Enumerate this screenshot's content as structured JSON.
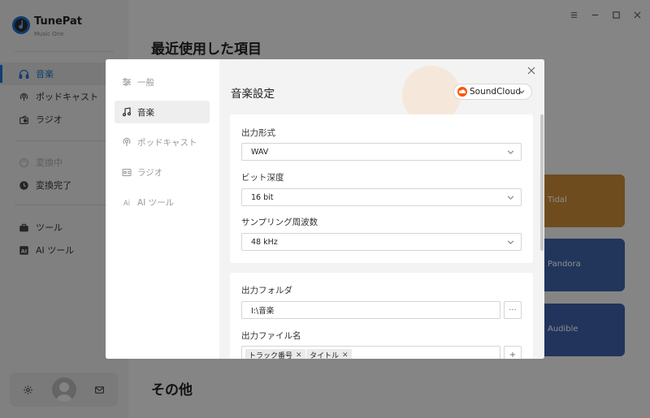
{
  "app": {
    "name": "TunePat",
    "subtitle": "Music One",
    "nav_sources": [
      {
        "label": "音楽",
        "icon": "headphones-icon"
      },
      {
        "label": "ポッドキャスト",
        "icon": "podcast-icon"
      },
      {
        "label": "ラジオ",
        "icon": "radio-icon"
      }
    ],
    "nav_tasks": [
      {
        "label": "変換中",
        "icon": "converting-icon"
      },
      {
        "label": "変換完了",
        "icon": "clock-icon"
      }
    ],
    "nav_tools": [
      {
        "label": "ツール",
        "icon": "toolbox-icon"
      },
      {
        "label": "AI ツール",
        "icon": "ai-icon"
      }
    ]
  },
  "main": {
    "title": "最近使用した項目",
    "section2_title": "その他",
    "tiles": [
      {
        "label": "Tidal",
        "color": "#c98a37"
      },
      {
        "label": "Pandora",
        "color": "#3e63a8"
      },
      {
        "label": "Audible",
        "color": "#3e5ea8"
      }
    ]
  },
  "settings": {
    "nav": [
      {
        "label": "一般",
        "icon": "sliders-icon"
      },
      {
        "label": "音楽",
        "icon": "music-note-icon"
      },
      {
        "label": "ポッドキャスト",
        "icon": "podcast-icon"
      },
      {
        "label": "ラジオ",
        "icon": "radio-icon"
      },
      {
        "label": "AI ツール",
        "icon": "ai-icon"
      }
    ],
    "heading": "音楽設定",
    "source": "SoundCloud",
    "fields": {
      "format_label": "出力形式",
      "format_value": "WAV",
      "bitdepth_label": "ビット深度",
      "bitdepth_value": "16 bit",
      "samplerate_label": "サンプリング周波数",
      "samplerate_value": "48 kHz",
      "folder_label": "出力フォルダ",
      "folder_value": "I:\\音楽",
      "folder_browse": "···",
      "filename_label": "出力ファイル名",
      "filename_chips": [
        "トラック番号",
        "タイトル"
      ],
      "filename_add": "+"
    }
  }
}
